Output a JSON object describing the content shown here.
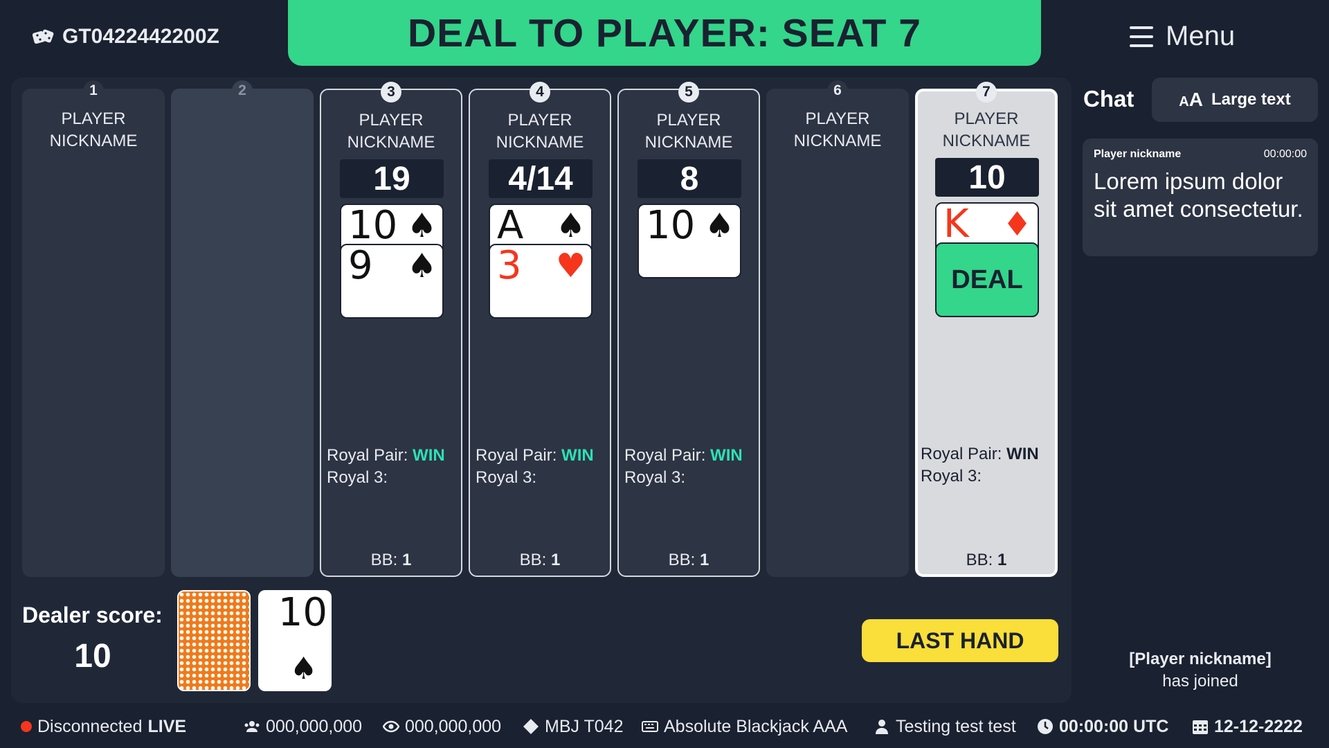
{
  "header": {
    "game_id": "GT0422442200Z",
    "banner": "DEAL TO PLAYER: SEAT 7",
    "menu_label": "Menu"
  },
  "seats": [
    {
      "number": "1",
      "name": "PLAYER NICKNAME",
      "state": "inactive"
    },
    {
      "number": "2",
      "name": "",
      "state": "empty"
    },
    {
      "number": "3",
      "name": "PLAYER NICKNAME",
      "score": "19",
      "cards": [
        {
          "rank": "10",
          "suit": "♠"
        },
        {
          "rank": "9",
          "suit": "♠"
        }
      ],
      "royal_pair_label": "Royal Pair:",
      "royal_pair": "WIN",
      "royal3_label": "Royal 3:",
      "bb_label": "BB:",
      "bb": "1"
    },
    {
      "number": "4",
      "name": "PLAYER NICKNAME",
      "score": "4/14",
      "cards": [
        {
          "rank": "A",
          "suit": "♠"
        },
        {
          "rank": "3",
          "suit": "♥"
        }
      ],
      "royal_pair_label": "Royal Pair:",
      "royal_pair": "WIN",
      "royal3_label": "Royal 3:",
      "bb_label": "BB:",
      "bb": "1"
    },
    {
      "number": "5",
      "name": "PLAYER NICKNAME",
      "score": "8",
      "cards": [
        {
          "rank": "10",
          "suit": "♠"
        }
      ],
      "royal_pair_label": "Royal Pair:",
      "royal_pair": "WIN",
      "royal3_label": "Royal 3:",
      "bb_label": "BB:",
      "bb": "1"
    },
    {
      "number": "6",
      "name": "PLAYER NICKNAME",
      "state": "inactive"
    },
    {
      "number": "7",
      "name": "PLAYER NICKNAME",
      "score": "10",
      "cards": [
        {
          "rank": "K",
          "suit": "♦"
        }
      ],
      "deal_label": "DEAL",
      "royal_pair_label": "Royal Pair:",
      "royal_pair": "WIN",
      "royal3_label": "Royal 3:",
      "bb_label": "BB:",
      "bb": "1"
    }
  ],
  "dealer": {
    "label": "Dealer score:",
    "score": "10",
    "card": {
      "rank": "10",
      "suit": "♠"
    }
  },
  "last_hand_label": "LAST HAND",
  "chat": {
    "title": "Chat",
    "large_text_label": "Large text",
    "message": {
      "nickname": "Player nickname",
      "time": "00:00:00",
      "text": "Lorem ipsum dolor sit amet consectetur."
    },
    "joined_nick": "[Player nickname]",
    "joined_text": "has joined"
  },
  "status": {
    "connection": "Disconnected",
    "live": "LIVE",
    "players": "000,000,000",
    "viewers": "000,000,000",
    "table_code": "MBJ T042",
    "table_name": "Absolute Blackjack AAA",
    "user": "Testing test test",
    "time": "00:00:00 UTC",
    "date": "12-12-2222"
  },
  "colors": {
    "background": "#1a2130",
    "banner": "#33d68a",
    "deal_button": "#33d68a",
    "last_hand_button": "#fade3a",
    "win": "#2de0b4",
    "red_suit": "#f5361c",
    "disconnected_dot": "#f5361c"
  }
}
